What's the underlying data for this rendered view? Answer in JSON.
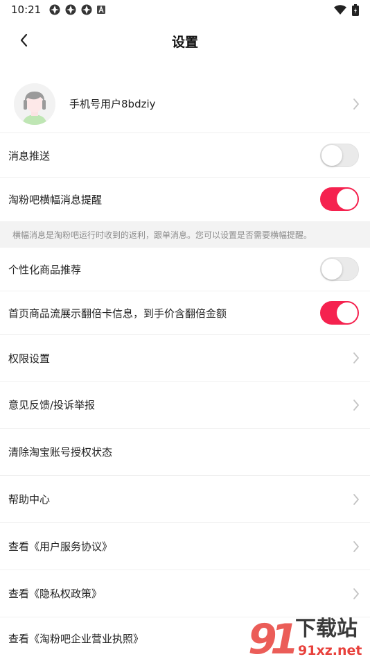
{
  "status": {
    "time": "10:21",
    "icons": [
      "app-icon",
      "app-icon",
      "app-icon",
      "a-box-icon"
    ],
    "right_icons": [
      "wifi-icon",
      "battery-icon"
    ]
  },
  "header": {
    "title": "设置",
    "back_icon": "chevron-left-icon"
  },
  "profile": {
    "name": "手机号用户8bdziy",
    "avatar": "avatar-icon"
  },
  "settings": {
    "push": {
      "label": "消息推送",
      "on": false
    },
    "banner": {
      "label": "淘粉吧横幅消息提醒",
      "on": true
    },
    "note": "横幅消息是淘粉吧运行时收到的返利，跟单消息。您可以设置是否需要横幅提醒。",
    "personalized": {
      "label": "个性化商品推荐",
      "on": false
    },
    "double_card": {
      "label": "首页商品流展示翻倍卡信息，到手价含翻倍金额",
      "on": true
    },
    "permissions": {
      "label": "权限设置"
    },
    "feedback": {
      "label": "意见反馈/投诉举报"
    },
    "clear_auth": {
      "label": "清除淘宝账号授权状态"
    },
    "help": {
      "label": "帮助中心"
    },
    "terms": {
      "label": "查看《用户服务协议》"
    },
    "privacy": {
      "label": "查看《隐私权政策》"
    },
    "license": {
      "label": "查看《淘粉吧企业营业执照》"
    }
  },
  "watermark": {
    "line1": "下载站",
    "line2": "91xz.net"
  },
  "colors": {
    "accent": "#f5224f",
    "toggle_off": "#eaeaea",
    "note_bg": "#f3f3f3"
  }
}
